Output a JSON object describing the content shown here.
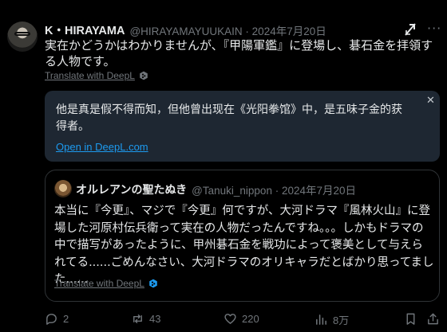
{
  "tweet": {
    "author_name": "K・HIRAYAMA",
    "author_meta": "@HIRAYAMAYUUKAIN · 2024年7月20日",
    "text": "実在かどうかはわかりませんが、『甲陽軍鑑』に登場し、碁石金を拝領する人物です。",
    "translate_label": "Translate with DeepL"
  },
  "translation": {
    "text": "他是真是假不得而知，但他曾出现在《光阳拳馆》中，是五味子金的获得者。",
    "close_label": "✕",
    "open_link": "Open in DeepL.com"
  },
  "quote": {
    "author_name": "オルレアンの聖たぬき",
    "author_meta": "@Tanuki_nippon · 2024年7月20日",
    "text": "本当に『今更』、マジで『今更』何ですが、大河ドラマ『風林火山』に登場した河原村伝兵衛って実在の人物だったんですね。。。しかもドラマの中で描写があったように、甲州碁石金を戦功によって褒美として与えられてる......ごめんなさい、大河ドラマのオリキャラだとばかり思ってました......",
    "translate_label": "Translate with DeepL"
  },
  "actions": {
    "replies": "2",
    "reposts": "43",
    "likes": "220",
    "views": "8万"
  },
  "colors": {
    "background": "#000000",
    "text": "#e7e9ea",
    "muted": "#71767b",
    "link": "#1d9bf0",
    "translation_bg": "#1e2732",
    "border": "#2f3336"
  },
  "icons": [
    "grok-icon",
    "more-icon",
    "deepl-icon",
    "close-icon",
    "reply-icon",
    "repost-icon",
    "like-icon",
    "views-icon",
    "bookmark-icon",
    "share-icon"
  ]
}
